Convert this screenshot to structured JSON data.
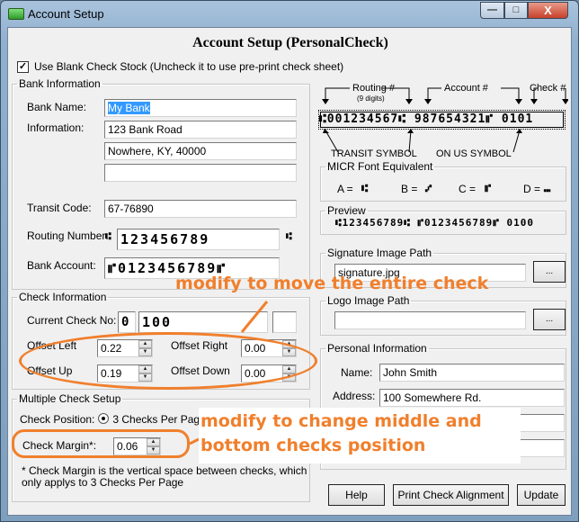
{
  "window": {
    "title": "Account Setup",
    "buttons": {
      "minimize": "—",
      "maximize": "□",
      "close": "X"
    }
  },
  "heading": "Account Setup (PersonalCheck)",
  "blank_check_stock": {
    "label": "Use Blank Check Stock (Uncheck it to use pre-print check sheet)",
    "checked": true,
    "mark": "✓"
  },
  "bank_information": {
    "group_label": "Bank Information",
    "bank_name_label": "Bank Name:",
    "bank_name_value": "My Bank",
    "information_label": "Information:",
    "information_line1": "123 Bank Road",
    "information_line2": "Nowhere, KY, 40000",
    "information_line3": "",
    "transit_code_label": "Transit Code:",
    "transit_code_value": "67-76890",
    "routing_number_label": "Routing Number:",
    "routing_symbol": "⑆",
    "routing_number_value": "123456789",
    "bank_account_label": "Bank Account:",
    "bank_account_value": "⑈0123456789⑈"
  },
  "check_information": {
    "group_label": "Check Information",
    "current_check_label": "Current Check No:",
    "current_check_prefix": "0",
    "current_check_value": "100",
    "current_check_suffix": "",
    "offset_left_label": "Offset Left",
    "offset_left_value": "0.22",
    "offset_right_label": "Offset Right",
    "offset_right_value": "0.00",
    "offset_up_label": "Offset Up",
    "offset_up_value": "0.19",
    "offset_down_label": "Offset Down",
    "offset_down_value": "0.00"
  },
  "multiple_check_setup": {
    "group_label": "Multiple Check Setup",
    "check_position_label": "Check Position:",
    "check_position_option": "3 Checks Per Page",
    "check_margin_label": "Check Margin*:",
    "check_margin_value": "0.06",
    "footnote_line1": "* Check Margin is the vertical space between checks, which",
    "footnote_line2": "only applys to 3 Checks Per Page"
  },
  "micr_diagram": {
    "routing_label": "Routing #",
    "routing_sub": "(9 digits)",
    "account_label": "Account #",
    "check_label": "Check #",
    "micr_line": "⑆001234567⑆  987654321⑈  0101",
    "transit_symbol_label": "TRANSIT SYMBOL",
    "on_us_symbol_label": "ON US SYMBOL"
  },
  "micr_font_equivalent": {
    "group_label": "MICR Font Equivalent",
    "items": [
      {
        "key": "A =",
        "glyph": "⑆"
      },
      {
        "key": "B =",
        "glyph": "⑇"
      },
      {
        "key": "C =",
        "glyph": "⑈"
      },
      {
        "key": "D =",
        "glyph": "⑉"
      }
    ]
  },
  "preview": {
    "group_label": "Preview",
    "value": "⑆123456789⑆ ⑈0123456789⑈  0100"
  },
  "signature_image": {
    "group_label": "Signature Image Path",
    "value": "signature.jpg",
    "browse_label": "..."
  },
  "logo_image": {
    "group_label": "Logo Image Path",
    "value": "",
    "browse_label": "..."
  },
  "personal_information": {
    "group_label": "Personal Information",
    "name_label": "Name:",
    "name_value": "John Smith",
    "address_label": "Address:",
    "address_value": "100 Somewhere Rd.",
    "address_line2": "",
    "address_line3": ""
  },
  "buttons": {
    "help": "Help",
    "print_alignment": "Print Check Alignment",
    "update": "Update"
  },
  "annotations": {
    "offsets": "modify to move the entire check",
    "margin_line1": "modify to change middle and",
    "margin_line2": "bottom checks position",
    "color": "#f07f2c"
  }
}
